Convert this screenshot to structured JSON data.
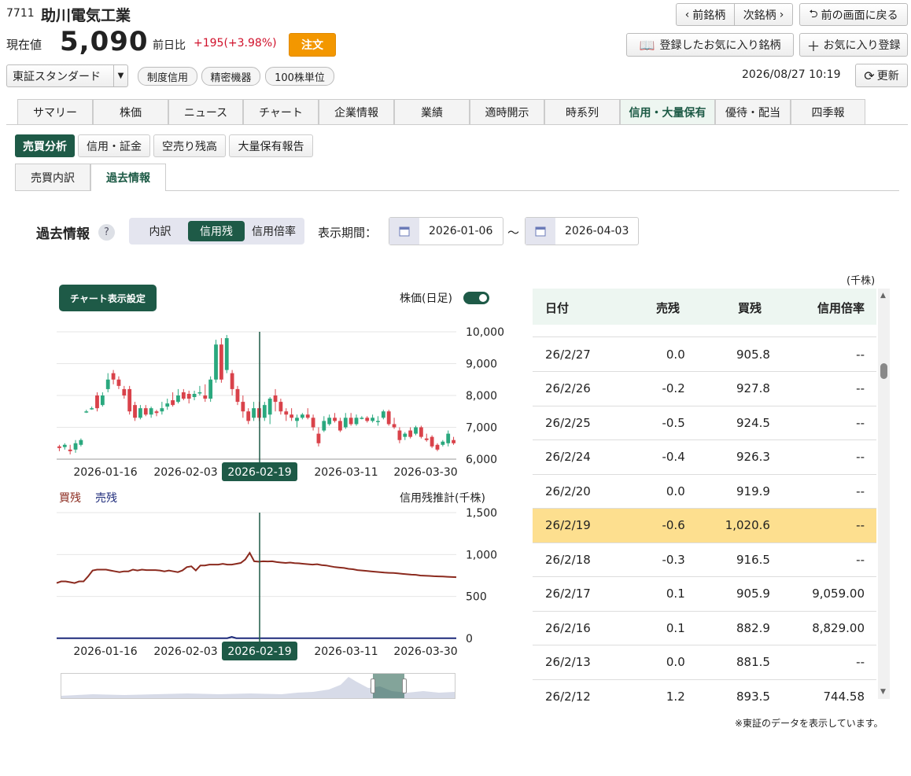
{
  "stock": {
    "code": "7711",
    "name": "助川電気工業",
    "price_label": "現在値",
    "price": "5,090",
    "change_label": "前日比",
    "change": "+195(+3.98%)",
    "order_label": "注文"
  },
  "nav": {
    "prev_label": "前銘柄",
    "next_label": "次銘柄",
    "back_label": "前の画面に戻る",
    "favorites_label": "登録したお気に入り銘柄",
    "add_favorite_label": "お気に入り登録",
    "refresh_label": "更新",
    "timestamp": "2026/08/27 10:19"
  },
  "market": {
    "selected": "東証スタンダード",
    "tags": [
      "制度信用",
      "精密機器",
      "100株単位"
    ]
  },
  "tabs": [
    "サマリー",
    "株価",
    "ニュース",
    "チャート",
    "企業情報",
    "業績",
    "適時開示",
    "時系列",
    "信用・大量保有",
    "優待・配当",
    "四季報"
  ],
  "active_tab": "信用・大量保有",
  "subnav": [
    "売買分析",
    "信用・証金",
    "空売り残高",
    "大量保有報告"
  ],
  "subtabs": [
    "売買内訳",
    "過去情報"
  ],
  "panel": {
    "title": "過去情報",
    "help": "?",
    "segments": [
      "内訳",
      "信用残",
      "信用倍率"
    ],
    "active_segment": "信用残",
    "period_label": "表示期間：",
    "date_from": "2026-01-06",
    "tilde": "〜",
    "date_to": "2026-04-03"
  },
  "chart_controls": {
    "settings_label": "チャート表示設定",
    "toggle_label": "株価(日足)",
    "toggle_on": true,
    "buy_label": "買残",
    "sell_label": "売残",
    "lower_title": "信用残推計(千株)",
    "cursor_label": "2026-02-19"
  },
  "chart_data": [
    {
      "type": "candlestick",
      "y_ticks": [
        "10,000",
        "9,000",
        "8,000",
        "7,000",
        "6,000"
      ],
      "ylim": [
        6000,
        10000
      ],
      "x_ticks": [
        "2026-01-16",
        "2026-02-03",
        "2026-02-19",
        "2026-03-11",
        "2026-03-30"
      ],
      "candles": [
        [
          6400,
          6350,
          6250,
          6450
        ],
        [
          6380,
          6450,
          6300,
          6500
        ],
        [
          6300,
          6250,
          6150,
          6450
        ],
        [
          6300,
          6500,
          6200,
          6600
        ],
        [
          6450,
          6600,
          6400,
          6650
        ],
        [
          7500,
          7500,
          7450,
          7550
        ],
        [
          7600,
          7600,
          7550,
          7650
        ],
        [
          8000,
          7600,
          7500,
          8100
        ],
        [
          7700,
          8000,
          7650,
          8100
        ],
        [
          8200,
          8500,
          8100,
          8700
        ],
        [
          8700,
          8500,
          8350,
          8800
        ],
        [
          8500,
          8300,
          8200,
          8600
        ],
        [
          8200,
          8000,
          7900,
          8300
        ],
        [
          8200,
          7500,
          7400,
          8300
        ],
        [
          7700,
          7300,
          7200,
          7800
        ],
        [
          7300,
          7600,
          7250,
          7700
        ],
        [
          7600,
          7400,
          7350,
          7700
        ],
        [
          7400,
          7600,
          7300,
          7650
        ],
        [
          7500,
          7450,
          7350,
          7550
        ],
        [
          7500,
          7600,
          7400,
          7800
        ],
        [
          7650,
          7750,
          7550,
          7900
        ],
        [
          7850,
          7700,
          7650,
          8100
        ],
        [
          7800,
          8000,
          7750,
          8200
        ],
        [
          8100,
          7900,
          7850,
          8200
        ],
        [
          8050,
          7900,
          7750,
          8150
        ],
        [
          7950,
          8050,
          7850,
          8150
        ],
        [
          8100,
          8100,
          8000,
          8300
        ],
        [
          8000,
          7900,
          7800,
          8350
        ],
        [
          7900,
          8500,
          7800,
          8600
        ],
        [
          8500,
          9600,
          8400,
          9750
        ],
        [
          9600,
          8500,
          8400,
          9800
        ],
        [
          8800,
          9800,
          8700,
          9900
        ],
        [
          8700,
          8200,
          8000,
          8800
        ],
        [
          8200,
          7800,
          7700,
          8300
        ],
        [
          7800,
          7500,
          7300,
          8000
        ],
        [
          7500,
          7200,
          7100,
          7600
        ],
        [
          7300,
          7600,
          7200,
          7800
        ],
        [
          7600,
          7300,
          7200,
          7800
        ],
        [
          7300,
          7700,
          7200,
          7800
        ],
        [
          7400,
          7900,
          7100,
          7950
        ],
        [
          8000,
          7800,
          7500,
          8200
        ],
        [
          7800,
          7500,
          7400,
          7900
        ],
        [
          7500,
          7400,
          7200,
          7600
        ],
        [
          7400,
          7300,
          7200,
          7600
        ],
        [
          7200,
          7300,
          7000,
          7400
        ],
        [
          7300,
          7400,
          7250,
          7450
        ],
        [
          7400,
          7300,
          7250,
          7600
        ],
        [
          7300,
          7000,
          6900,
          7400
        ],
        [
          6800,
          6500,
          6400,
          7000
        ],
        [
          6900,
          7200,
          6850,
          7350
        ],
        [
          7100,
          7300,
          7050,
          7400
        ],
        [
          7300,
          7200,
          7150,
          7450
        ],
        [
          7200,
          6900,
          6850,
          7300
        ],
        [
          7000,
          7300,
          6950,
          7450
        ],
        [
          7300,
          7100,
          7050,
          7450
        ],
        [
          7100,
          7300,
          7050,
          7400
        ],
        [
          7300,
          7300,
          7250,
          7350
        ],
        [
          7300,
          7200,
          7150,
          7350
        ],
        [
          7200,
          7300,
          7150,
          7400
        ],
        [
          7200,
          7200,
          7050,
          7350
        ],
        [
          7300,
          7500,
          7250,
          7550
        ],
        [
          7500,
          7100,
          7050,
          7550
        ],
        [
          7100,
          7000,
          6950,
          7300
        ],
        [
          6900,
          6600,
          6500,
          7000
        ],
        [
          6700,
          6800,
          6600,
          6850
        ],
        [
          6900,
          6700,
          6650,
          7000
        ],
        [
          6800,
          7000,
          6750,
          7050
        ],
        [
          7000,
          6700,
          6650,
          7050
        ],
        [
          6650,
          6600,
          6550,
          6800
        ],
        [
          6700,
          6400,
          6350,
          6750
        ],
        [
          6450,
          6300,
          6250,
          6500
        ],
        [
          6450,
          6550,
          6400,
          6600
        ],
        [
          6500,
          6800,
          6400,
          6900
        ],
        [
          6600,
          6500,
          6450,
          6700
        ]
      ]
    },
    {
      "type": "line",
      "y_ticks": [
        "1,500",
        "1,000",
        "500",
        "0"
      ],
      "ylim": [
        0,
        1500
      ],
      "x_ticks": [
        "2026-01-16",
        "2026-02-03",
        "2026-02-19",
        "2026-03-11",
        "2026-03-30"
      ],
      "series": [
        {
          "name": "買残",
          "color": "#8b2a1e",
          "values": [
            660,
            680,
            680,
            670,
            660,
            680,
            680,
            740,
            810,
            820,
            820,
            820,
            810,
            800,
            790,
            800,
            800,
            820,
            810,
            820,
            815,
            815,
            815,
            810,
            800,
            810,
            800,
            790,
            810,
            850,
            860,
            810,
            870,
            870,
            880,
            880,
            880,
            890,
            880,
            880,
            890,
            900,
            940,
            1020,
            920,
            915,
            920,
            918,
            920,
            910,
            905,
            900,
            905,
            898,
            895,
            890,
            885,
            880,
            885,
            875,
            870,
            860,
            850,
            845,
            840,
            830,
            825,
            815,
            810,
            805,
            800,
            795,
            790,
            785,
            782,
            780,
            775,
            770,
            765,
            760,
            758,
            750,
            748,
            745,
            742,
            740,
            738,
            735,
            732,
            730
          ]
        },
        {
          "name": "売残",
          "color": "#1d2a7a",
          "values": [
            3,
            3,
            3,
            3,
            3,
            3,
            3,
            3,
            3,
            3,
            3,
            3,
            3,
            3,
            3,
            3,
            3,
            3,
            3,
            3,
            3,
            3,
            3,
            3,
            3,
            3,
            3,
            3,
            3,
            3,
            3,
            3,
            3,
            3,
            3,
            3,
            3,
            3,
            3,
            18,
            3,
            3,
            3,
            3,
            3,
            3,
            3,
            3,
            3,
            3,
            3,
            3,
            3,
            3,
            3,
            3,
            3,
            3,
            3,
            3,
            3,
            3,
            3,
            3,
            3,
            3,
            3,
            3,
            3,
            3,
            3,
            3,
            3,
            3,
            3,
            3,
            3,
            3,
            3,
            3,
            3,
            3,
            3,
            3,
            3,
            3,
            3,
            3,
            3,
            3
          ]
        }
      ]
    }
  ],
  "table": {
    "unit": "(千株)",
    "headers": [
      "日付",
      "売残",
      "買残",
      "信用倍率"
    ],
    "rows": [
      [
        "26/2/27",
        "0.0",
        "905.8",
        "--"
      ],
      [
        "26/2/26",
        "-0.2",
        "927.8",
        "--"
      ],
      [
        "26/2/25",
        "-0.5",
        "924.5",
        "--"
      ],
      [
        "26/2/24",
        "-0.4",
        "926.3",
        "--"
      ],
      [
        "26/2/20",
        "0.0",
        "919.9",
        "--"
      ],
      [
        "26/2/19",
        "-0.6",
        "1,020.6",
        "--"
      ],
      [
        "26/2/18",
        "-0.3",
        "916.5",
        "--"
      ],
      [
        "26/2/17",
        "0.1",
        "905.9",
        "9,059.00"
      ],
      [
        "26/2/16",
        "0.1",
        "882.9",
        "8,829.00"
      ],
      [
        "26/2/13",
        "0.0",
        "881.5",
        "--"
      ],
      [
        "26/2/12",
        "1.2",
        "893.5",
        "744.58"
      ]
    ],
    "highlight_index": 5,
    "footnote": "※東証のデータを表示しています。"
  }
}
